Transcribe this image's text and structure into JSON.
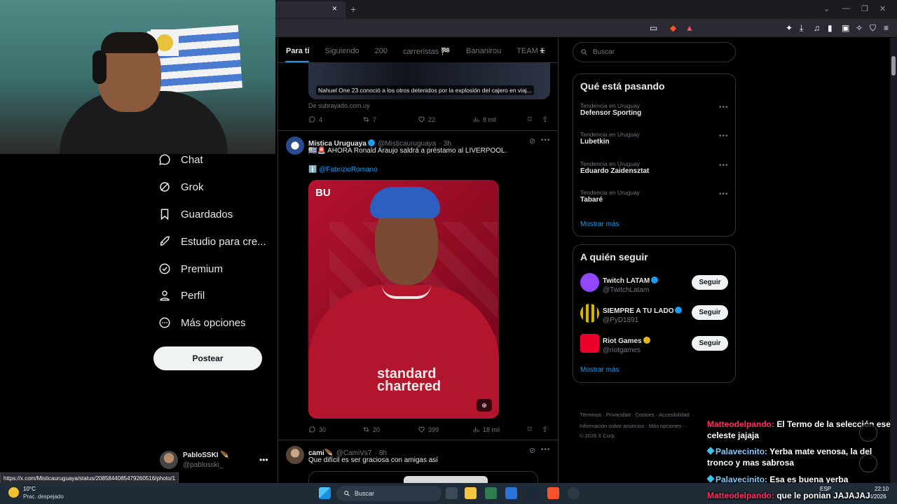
{
  "browser": {
    "close_tab": "×",
    "new_tab": "+",
    "win_min": "⌄",
    "win_minimize": "—",
    "win_max": "❐",
    "win_close": "✕"
  },
  "nav": {
    "items": [
      {
        "label": "Chat",
        "icon": "chat-icon"
      },
      {
        "label": "Grok",
        "icon": "grok-icon"
      },
      {
        "label": "Guardados",
        "icon": "bookmark-icon"
      },
      {
        "label": "Estudio para cre...",
        "icon": "rocket-icon"
      },
      {
        "label": "Premium",
        "icon": "premium-icon"
      },
      {
        "label": "Perfil",
        "icon": "person-icon"
      },
      {
        "label": "Más opciones",
        "icon": "more-circle-icon"
      }
    ],
    "post_label": "Postear",
    "account_name": "PabloSSKI 🪶",
    "account_handle": "@pablosski_",
    "account_more": "•••"
  },
  "status_url": "https://x.com/Misticauruguaya/status/2085844085479260516/photo/1",
  "tabs": [
    "Para ti",
    "Siguiendo",
    "200",
    "carreristas 🏁",
    "Bananirou",
    "TEAM E"
  ],
  "tab_plus": "+",
  "tweet1": {
    "media_caption": "Nahuel One 23 conoció a los otros detenidos por la explosión del cajero en viaj...",
    "source": "De subrayado.com.uy",
    "replies": "4",
    "reposts": "7",
    "likes": "22",
    "views": "8 mil"
  },
  "tweet2": {
    "name": "Mística Uruguaya",
    "handle": "@Misticauruguaya",
    "time": "· 3h",
    "more": "•••",
    "text": "🇺🇾🚨 AHORA Ronald Araujo saldrá a préstamo al LIVERPOOL.",
    "mention": "ℹ️ @FabrizioRomano",
    "photo_logo": "BU",
    "photo_sponsor_1": "standard",
    "photo_sponsor_2": "chartered",
    "photo_badge": "⊕",
    "replies": "30",
    "reposts": "20",
    "likes": "399",
    "views": "18 mil"
  },
  "tweet3": {
    "name": "cami🪶",
    "handle": "@CamiVs7",
    "time": "· 8h",
    "more": "•••",
    "text": "Que difícil es ser graciosa con amigas así"
  },
  "right": {
    "search_placeholder": "Buscar",
    "trending_title": "Qué está pasando",
    "trends": [
      {
        "context": "Tendencia en Uruguay",
        "name": "Defensor Sporting"
      },
      {
        "context": "Tendencia en Uruguay",
        "name": "Lubetkin"
      },
      {
        "context": "Tendencia en Uruguay",
        "name": "Eduardo Zaidensztat"
      },
      {
        "context": "Tendencia en Uruguay",
        "name": "Tabaré"
      }
    ],
    "trend_more_dots": "•••",
    "show_more": "Mostrar más",
    "follow_title": "A quién seguir",
    "follow": [
      {
        "name": "Twitch LATAM",
        "handle": "@TwitchLatam",
        "button": "Seguir",
        "color": "#9146ff",
        "badge": "blue"
      },
      {
        "name": "SIEMPRE A TU LADO",
        "handle": "@PyD1891",
        "button": "Seguir",
        "color": "#d6b400",
        "badge": "blue"
      },
      {
        "name": "Riot Games",
        "handle": "@riotgames",
        "button": "Seguir",
        "color": "#eb0029",
        "badge": "gold"
      }
    ],
    "follow_show_more": "Mostrar más",
    "footer_1": "Términos · Privacidad · Cookies · Accesibilidad ·",
    "footer_2": "Información sobre anuncios · Más opciones ···",
    "footer_3": "© 2026 X Corp."
  },
  "chat": [
    {
      "user": "Matteodelpando:",
      "message": "El Termo de la selección ese celeste jajaja",
      "color": "red"
    },
    {
      "user": "Palavecinito:",
      "message": "Yerba mate venosa, la del tronco y mas sabrosa",
      "color": "blue"
    },
    {
      "user": "Palavecinito:",
      "message": "Esa es buena yerba",
      "color": "blue"
    },
    {
      "user": "Matteodelpando:",
      "message": "que le ponian JAJAJAJ",
      "color": "red"
    }
  ],
  "taskbar": {
    "temp": "10°C",
    "weather": "Prac. despejado",
    "search": "Buscar",
    "lang": "ESP",
    "time": "22:10",
    "date": "/4/2026"
  }
}
